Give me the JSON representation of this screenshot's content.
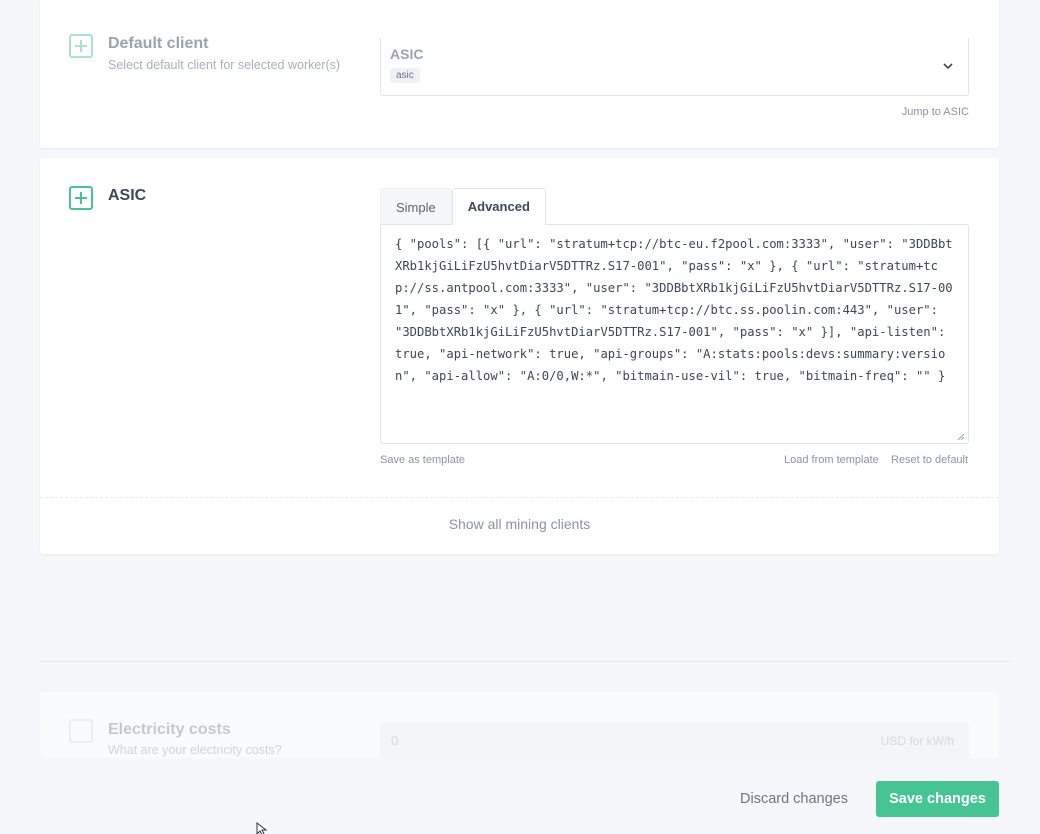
{
  "default_client": {
    "title": "Default client",
    "subtitle": "Select default client for selected worker(s)",
    "selected_label": "ASIC",
    "selected_tag": "asic",
    "jump_link": "Jump to ASIC"
  },
  "asic": {
    "title": "ASIC",
    "tabs": [
      {
        "label": "Simple",
        "active": false
      },
      {
        "label": "Advanced",
        "active": true
      }
    ],
    "config_text": "{ \"pools\": [{ \"url\": \"stratum+tcp://btc-eu.f2pool.com:3333\", \"user\": \"3DDBbtXRb1kjGiLiFzU5hvtDiarV5DTTRz.S17-001\", \"pass\": \"x\" }, { \"url\": \"stratum+tcp://ss.antpool.com:3333\", \"user\": \"3DDBbtXRb1kjGiLiFzU5hvtDiarV5DTTRz.S17-001\", \"pass\": \"x\" }, { \"url\": \"stratum+tcp://btc.ss.poolin.com:443\", \"user\": \"3DDBbtXRb1kjGiLiFzU5hvtDiarV5DTTRz.S17-001\", \"pass\": \"x\" }], \"api-listen\": true, \"api-network\": true, \"api-groups\": \"A:stats:pools:devs:summary:version\", \"api-allow\": \"A:0/0,W:*\", \"bitmain-use-vil\": true, \"bitmain-freq\": \"\" }",
    "save_as_template": "Save as template",
    "load_from_template": "Load from template",
    "reset_to_default": "Reset to default",
    "show_all": "Show all mining clients"
  },
  "electricity": {
    "title": "Electricity costs",
    "subtitle": "What are your electricity costs?",
    "value": "0",
    "unit": "USD for kW/h"
  },
  "footer": {
    "discard_label": "Discard changes",
    "save_label": "Save changes"
  },
  "colors": {
    "accent": "#47c494",
    "background": "#f6f7fb",
    "text": "#3c4858",
    "muted": "#8a94a2"
  }
}
